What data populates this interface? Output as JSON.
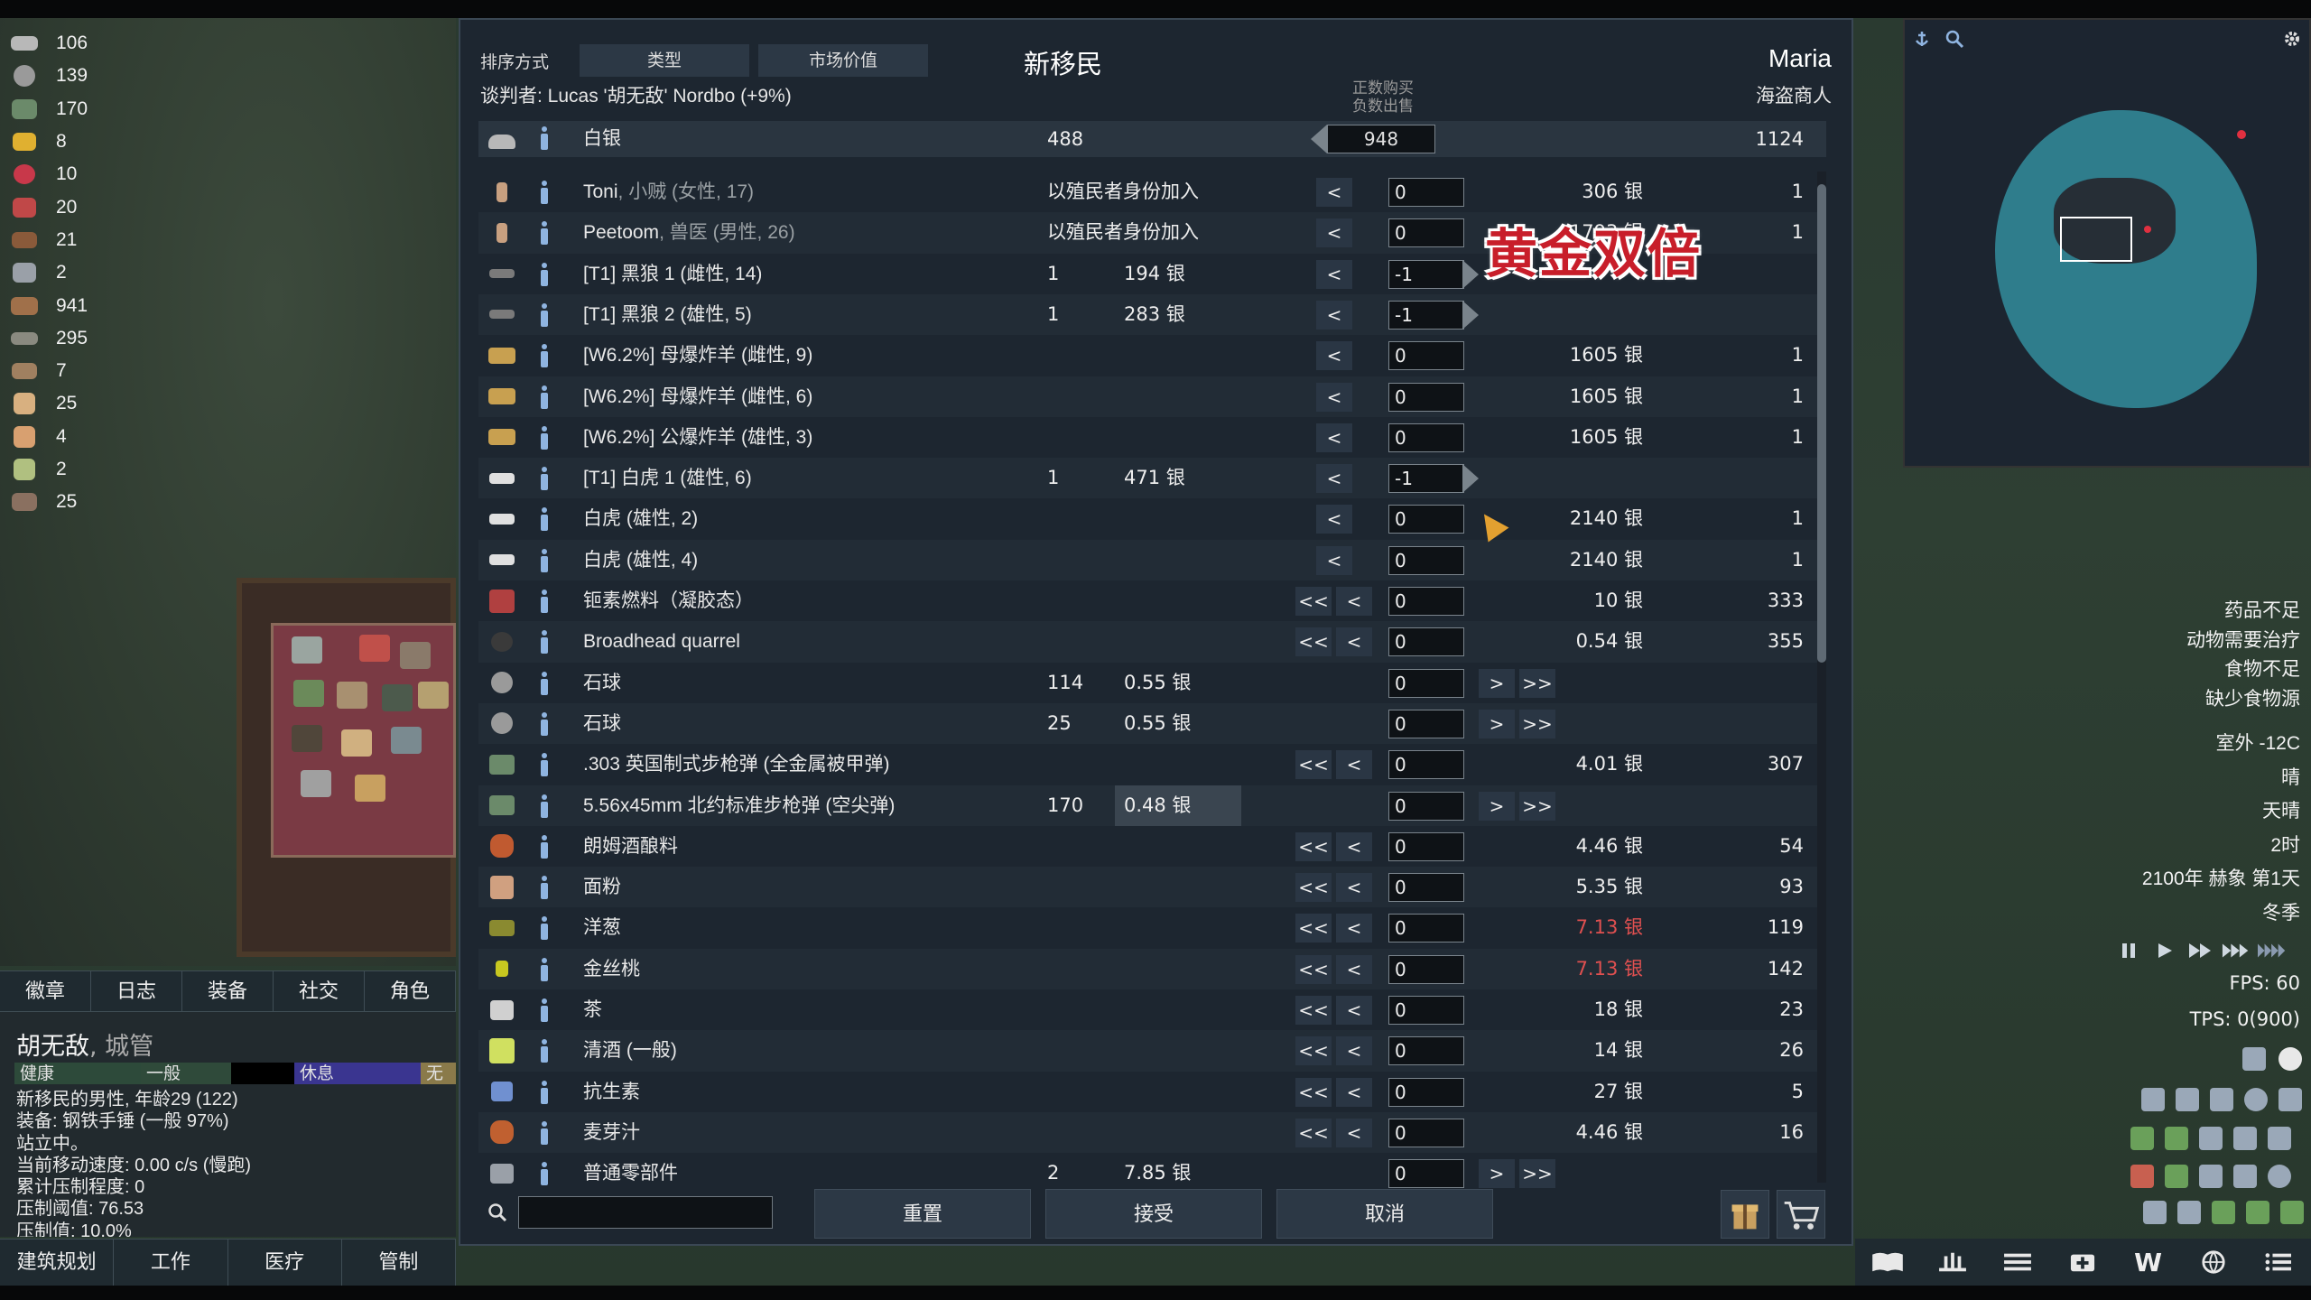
{
  "colors": {
    "accent": "#2c3845",
    "expensive": "#e05050",
    "panel": "#1d2630"
  },
  "resources": [
    {
      "icon": "silver-icon",
      "value": "106"
    },
    {
      "icon": "stone-ball-icon",
      "value": "139"
    },
    {
      "icon": "ammo-box-icon",
      "value": "170"
    },
    {
      "icon": "gold-icon",
      "value": "8"
    },
    {
      "icon": "berries-icon",
      "value": "10"
    },
    {
      "icon": "meat-icon",
      "value": "20"
    },
    {
      "icon": "wood-bundle-icon",
      "value": "21"
    },
    {
      "icon": "components-icon",
      "value": "2"
    },
    {
      "icon": "wood-log-icon",
      "value": "941"
    },
    {
      "icon": "steel-icon",
      "value": "295"
    },
    {
      "icon": "leather-icon",
      "value": "7"
    },
    {
      "icon": "packaged-meal-icon",
      "value": "25"
    },
    {
      "icon": "medicine-icon",
      "value": "4"
    },
    {
      "icon": "herbal-medicine-icon",
      "value": "2"
    },
    {
      "icon": "plank-icon",
      "value": "25"
    }
  ],
  "pawn_tabs": [
    "徽章",
    "日志",
    "装备",
    "社交",
    "角色"
  ],
  "pawn": {
    "name": "胡无敌",
    "role": ", 城管",
    "needs": [
      "健康",
      "一般",
      "",
      "休息",
      "无限"
    ],
    "info": [
      "新移民的男性, 年龄29 (122)",
      "装备: 钢铁手锤 (一般 97%)",
      "站立中。",
      "当前移动速度: 0.00 c/s (慢跑)",
      "累计压制程度: 0",
      "压制阈值: 76.53",
      "压制值: 10.0%"
    ]
  },
  "main_tabs": [
    "建筑规划",
    "工作",
    "医疗",
    "管制"
  ],
  "trade": {
    "sort_label": "排序方式",
    "sort_type": "类型",
    "sort_value": "市场价值",
    "title": "新移民",
    "negotiator": "谈判者: Lucas '胡无敌' Nordbo (+9%)",
    "trader_name": "Maria",
    "trader_type": "海盗商人",
    "hint_buy": "正数购买",
    "hint_sell": "负数出售",
    "overlay_text": "黄金双倍",
    "silver": {
      "label": "白银",
      "colony": "488",
      "delta": "948",
      "trader": "1124"
    },
    "rows": [
      {
        "icon": "colonist-icon",
        "name": "Toni",
        "extra": ", 小贼 (女性, 17)",
        "colony_count": "以殖民者身份加入",
        "colony_price": "",
        "left": "<",
        "qty": "0",
        "right": "",
        "trader_price": "306 银",
        "trader_count": "1"
      },
      {
        "icon": "colonist-icon",
        "name": "Peetoom",
        "extra": ", 兽医 (男性, 26)",
        "colony_count": "以殖民者身份加入",
        "colony_price": "",
        "left": "<",
        "qty": "0",
        "right": "",
        "trader_price": "1793 银",
        "trader_count": "1"
      },
      {
        "icon": "wolf-icon",
        "name": "[T1] 黑狼 1 (雌性, 14)",
        "extra": "",
        "colony_count": "1",
        "colony_price": "194 银",
        "left": "<",
        "qty": "-1",
        "right": "",
        "trader_price": "",
        "trader_count": ""
      },
      {
        "icon": "wolf-icon",
        "name": "[T1] 黑狼 2 (雄性, 5)",
        "extra": "",
        "colony_count": "1",
        "colony_price": "283 银",
        "left": "<",
        "qty": "-1",
        "right": "",
        "trader_price": "",
        "trader_count": ""
      },
      {
        "icon": "boomalope-icon",
        "name": "[W6.2%] 母爆炸羊 (雌性, 9)",
        "extra": "",
        "colony_count": "",
        "colony_price": "",
        "left": "<",
        "qty": "0",
        "right": "",
        "trader_price": "1605 银",
        "trader_count": "1"
      },
      {
        "icon": "boomalope-icon",
        "name": "[W6.2%] 母爆炸羊 (雌性, 6)",
        "extra": "",
        "colony_count": "",
        "colony_price": "",
        "left": "<",
        "qty": "0",
        "right": "",
        "trader_price": "1605 银",
        "trader_count": "1"
      },
      {
        "icon": "boomalope-icon",
        "name": "[W6.2%] 公爆炸羊 (雄性, 3)",
        "extra": "",
        "colony_count": "",
        "colony_price": "",
        "left": "<",
        "qty": "0",
        "right": "",
        "trader_price": "1605 银",
        "trader_count": "1"
      },
      {
        "icon": "white-tiger-icon",
        "name": "[T1] 白虎 1 (雄性, 6)",
        "extra": "",
        "colony_count": "1",
        "colony_price": "471 银",
        "left": "<",
        "qty": "-1",
        "right": "",
        "trader_price": "",
        "trader_count": ""
      },
      {
        "icon": "white-tiger-icon",
        "name": "白虎 (雄性, 2)",
        "extra": "",
        "colony_count": "",
        "colony_price": "",
        "left": "<",
        "qty": "0",
        "right": "",
        "trader_price": "2140 银",
        "trader_count": "1"
      },
      {
        "icon": "white-tiger-icon",
        "name": "白虎 (雄性, 4)",
        "extra": "",
        "colony_count": "",
        "colony_price": "",
        "left": "<",
        "qty": "0",
        "right": "",
        "trader_price": "2140 银",
        "trader_count": "1"
      },
      {
        "icon": "chemfuel-icon",
        "name": "钷素燃料（凝胶态）",
        "extra": "",
        "colony_count": "",
        "colony_price": "",
        "left": "<<|<",
        "qty": "0",
        "right": "",
        "trader_price": "10 银",
        "trader_count": "333"
      },
      {
        "icon": "quarrel-icon",
        "name": "Broadhead quarrel",
        "extra": "",
        "colony_count": "",
        "colony_price": "",
        "left": "<<|<",
        "qty": "0",
        "right": "",
        "trader_price": "0.54 银",
        "trader_count": "355"
      },
      {
        "icon": "stone-ball-icon",
        "name": "石球",
        "extra": "",
        "colony_count": "114",
        "colony_price": "0.55 银",
        "left": "",
        "qty": "0",
        "right": ">|>>",
        "trader_price": "",
        "trader_count": ""
      },
      {
        "icon": "stone-ball-icon",
        "name": "石球",
        "extra": "",
        "colony_count": "25",
        "colony_price": "0.55 银",
        "left": "",
        "qty": "0",
        "right": ">|>>",
        "trader_price": "",
        "trader_count": ""
      },
      {
        "icon": "ammo-box-icon",
        "name": ".303 英国制式步枪弹 (全金属被甲弹)",
        "extra": "",
        "colony_count": "",
        "colony_price": "",
        "left": "<<|<",
        "qty": "0",
        "right": "",
        "trader_price": "4.01 银",
        "trader_count": "307"
      },
      {
        "icon": "ammo-box-icon",
        "name": "5.56x45mm 北约标准步枪弹 (空尖弹)",
        "extra": "",
        "colony_count": "170",
        "colony_price": "0.48 银",
        "left": "",
        "qty": "0",
        "right": ">|>>",
        "trader_price": "",
        "trader_count": "",
        "highlight": true
      },
      {
        "icon": "wort-icon",
        "name": "朗姆酒酿料",
        "extra": "",
        "colony_count": "",
        "colony_price": "",
        "left": "<<|<",
        "qty": "0",
        "right": "",
        "trader_price": "4.46 银",
        "trader_count": "54"
      },
      {
        "icon": "flour-icon",
        "name": "面粉",
        "extra": "",
        "colony_count": "",
        "colony_price": "",
        "left": "<<|<",
        "qty": "0",
        "right": "",
        "trader_price": "5.35 银",
        "trader_count": "93"
      },
      {
        "icon": "onion-icon",
        "name": "洋葱",
        "extra": "",
        "colony_count": "",
        "colony_price": "",
        "left": "<<|<",
        "qty": "0",
        "right": "",
        "trader_price": "7.13 银",
        "trader_count": "119",
        "red": true
      },
      {
        "icon": "jalapeno-icon",
        "name": "金丝桃",
        "extra": "",
        "colony_count": "",
        "colony_price": "",
        "left": "<<|<",
        "qty": "0",
        "right": "",
        "trader_price": "7.13 银",
        "trader_count": "142",
        "red": true
      },
      {
        "icon": "tea-icon",
        "name": "茶",
        "extra": "",
        "colony_count": "",
        "colony_price": "",
        "left": "<<|<",
        "qty": "0",
        "right": "",
        "trader_price": "18 银",
        "trader_count": "23"
      },
      {
        "icon": "sake-icon",
        "name": "清酒 (一般)",
        "extra": "",
        "colony_count": "",
        "colony_price": "",
        "left": "<<|<",
        "qty": "0",
        "right": "",
        "trader_price": "14 银",
        "trader_count": "26"
      },
      {
        "icon": "antibiotic-icon",
        "name": "抗生素",
        "extra": "",
        "colony_count": "",
        "colony_price": "",
        "left": "<<|<",
        "qty": "0",
        "right": "",
        "trader_price": "27 银",
        "trader_count": "5"
      },
      {
        "icon": "malt-icon",
        "name": "麦芽汁",
        "extra": "",
        "colony_count": "",
        "colony_price": "",
        "left": "<<|<",
        "qty": "0",
        "right": "",
        "trader_price": "4.46 银",
        "trader_count": "16"
      },
      {
        "icon": "components-icon",
        "name": "普通零部件",
        "extra": "",
        "colony_count": "2",
        "colony_price": "7.85 银",
        "left": "",
        "qty": "0",
        "right": ">|>>",
        "trader_price": "",
        "trader_count": ""
      }
    ],
    "search_placeholder": "",
    "buttons": {
      "reset": "重置",
      "accept": "接受",
      "cancel": "取消"
    }
  },
  "alerts": [
    "药品不足",
    "动物需要治疗",
    "食物不足",
    "缺少食物源"
  ],
  "environment": [
    "室外 -12C",
    "晴",
    "天晴",
    "2时",
    "2100年 赫象 第1天",
    "冬季"
  ],
  "fps": "FPS: 60",
  "tps": "TPS: 0(900)",
  "bottom_bar_w": "W"
}
